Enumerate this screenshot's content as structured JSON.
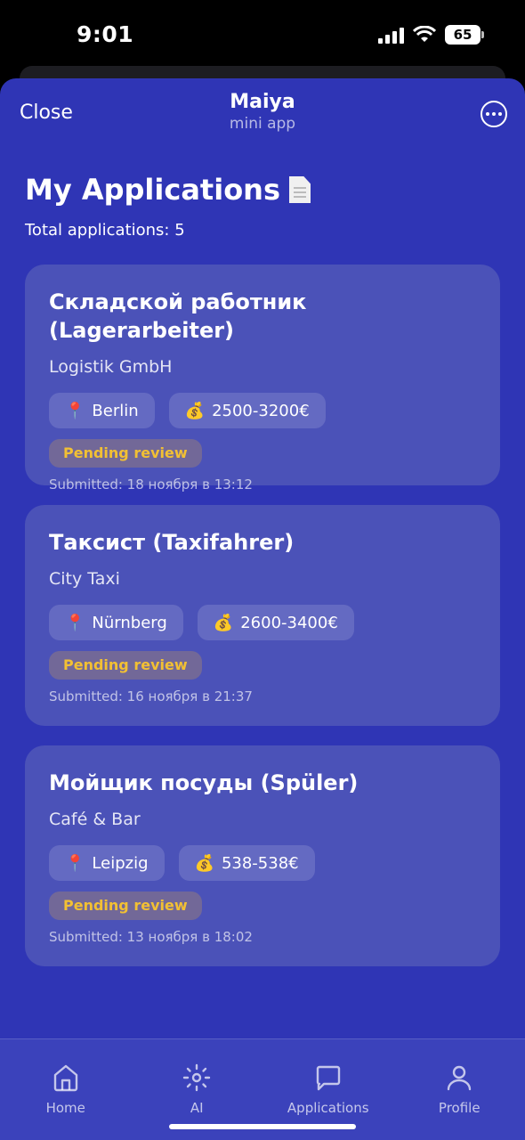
{
  "status": {
    "time": "9:01",
    "battery": "65"
  },
  "header": {
    "close_label": "Close",
    "title": "Maiya",
    "subtitle": "mini app"
  },
  "page": {
    "title": "My Applications",
    "total": "Total applications: 5"
  },
  "applications": [
    {
      "title": "Складской работник (Lagerarbeiter)",
      "company": "Logistik GmbH",
      "location": "Berlin",
      "salary": "2500-3200€",
      "status": "Pending review",
      "submitted": "Submitted: 18 ноября в 13:12"
    },
    {
      "title": "Таксист (Taxifahrer)",
      "company": "City Taxi",
      "location": "Nürnberg",
      "salary": "2600-3400€",
      "status": "Pending review",
      "submitted": "Submitted: 16 ноября в 21:37"
    },
    {
      "title": "Мойщик посуды (Spüler)",
      "company": "Café & Bar",
      "location": "Leipzig",
      "salary": "538-538€",
      "status": "Pending review",
      "submitted": "Submitted: 13 ноября в 18:02"
    }
  ],
  "tabs": [
    {
      "label": "Home",
      "icon": "home-icon"
    },
    {
      "label": "AI",
      "icon": "sparkle-icon"
    },
    {
      "label": "Applications",
      "icon": "chat-icon"
    },
    {
      "label": "Profile",
      "icon": "person-icon"
    }
  ],
  "colors": {
    "background": "#2f35b5",
    "card": "#4b52b8",
    "status_pending": "#f2c033"
  }
}
